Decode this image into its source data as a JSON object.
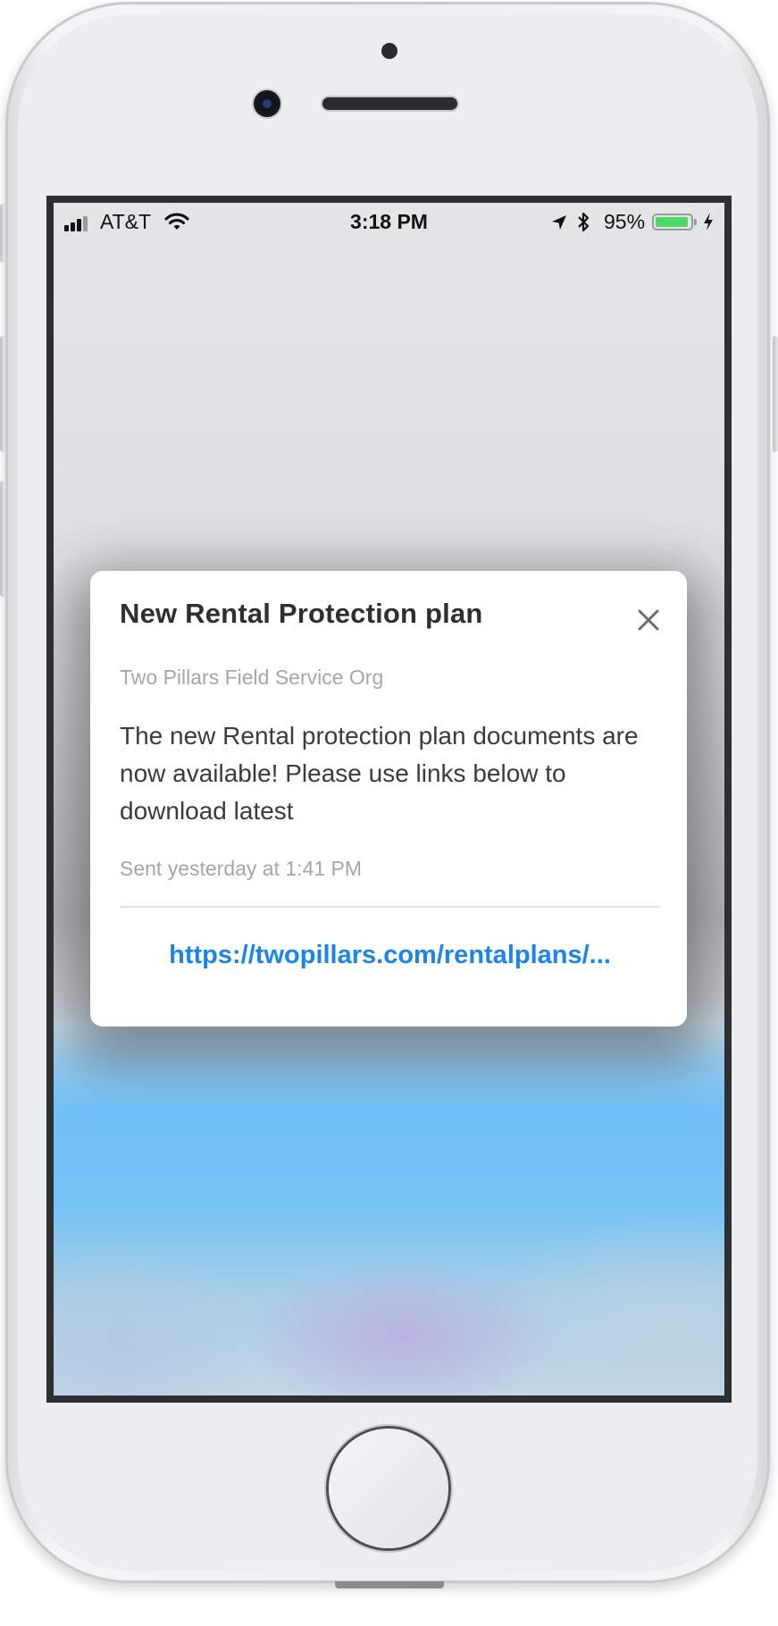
{
  "status_bar": {
    "carrier": "AT&T",
    "time": "3:18 PM",
    "battery_percent": "95%",
    "battery_level": 0.95,
    "icons": [
      "signal-icon",
      "wifi-icon",
      "location-icon",
      "bluetooth-icon",
      "battery-icon",
      "charging-icon"
    ]
  },
  "notification_modal": {
    "title": "New Rental Protection plan",
    "organization": "Two Pillars Field Service Org",
    "body": "The new Rental protection plan documents are now available! Please use links below to download latest",
    "sent": "Sent yesterday at 1:41 PM",
    "link": "https://twopillars.com/rentalplans/...",
    "close_icon": "close-icon"
  },
  "colors": {
    "link": "#1b85e8",
    "battery": "#4cd964",
    "title": "#2e2f33",
    "muted": "#a4a6ab"
  }
}
